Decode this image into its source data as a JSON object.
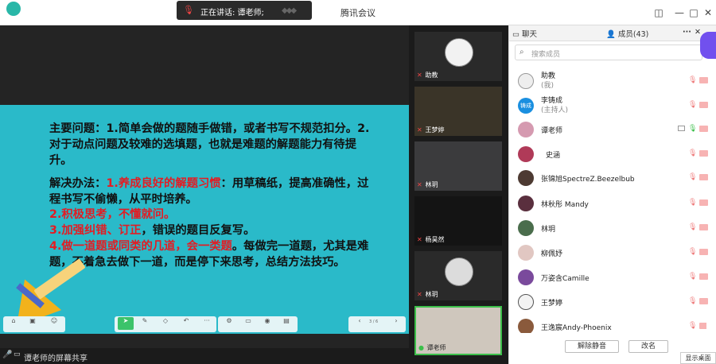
{
  "window": {
    "title": "腾讯会议"
  },
  "speaking": {
    "text": "正在讲话: 谭老师;"
  },
  "slide": {
    "para1": "主要问题：1.简单会做的题随手做错，或者书写不规范扣分。2.对于动点问题及较难的选填题，也就是难题的解题能力有待提升。",
    "p2a": "解决办法：",
    "p2b": "1.养成良好的解题习惯",
    "p2c": "：用草稿纸，提高准确性，过程书写不偷懒，从平时培养。",
    "p3": "2.积极思考，不懂就问。",
    "p4a": "3.加强纠错、订正",
    "p4b": "，错误的题目反复写。",
    "p5a": "4.做一道题或同类的几道，会一类题",
    "p5b": "。每做完一道题，尤其是难题，不着急去做下一道，而是停下来思考，总结方法技巧。"
  },
  "toolbar": {
    "pager": "3 / 6"
  },
  "share_label": "谭老师的屏幕共享",
  "videos": [
    {
      "name": "助教"
    },
    {
      "name": "王梦婷"
    },
    {
      "name": "林玥"
    },
    {
      "name": "杨昊然"
    },
    {
      "name": "林玥"
    },
    {
      "name": "谭老师"
    }
  ],
  "panel": {
    "tab_chat": "聊天",
    "tab_members": "成员(43)",
    "more": "···",
    "close": "✕",
    "search_placeholder": "搜索成员",
    "members": [
      {
        "name": "助教",
        "sub": "(我)"
      },
      {
        "name": "李铸成",
        "sub": "(主持人)"
      },
      {
        "name": "谭老师"
      },
      {
        "name": "史涵"
      },
      {
        "name": "张锦旭SpectreZ.Beezelbub"
      },
      {
        "name": "林秋彤 Mandy"
      },
      {
        "name": "林玥"
      },
      {
        "name": "柳佩妤"
      },
      {
        "name": "万姿含Camille"
      },
      {
        "name": "王梦婷"
      },
      {
        "name": "王逸宸Andy-Phoenix"
      }
    ],
    "btn_unmute": "解除静音",
    "btn_rename": "改名",
    "btn_desktop": "显示桌面"
  },
  "avatar_texts": {
    "li": "铸成"
  }
}
